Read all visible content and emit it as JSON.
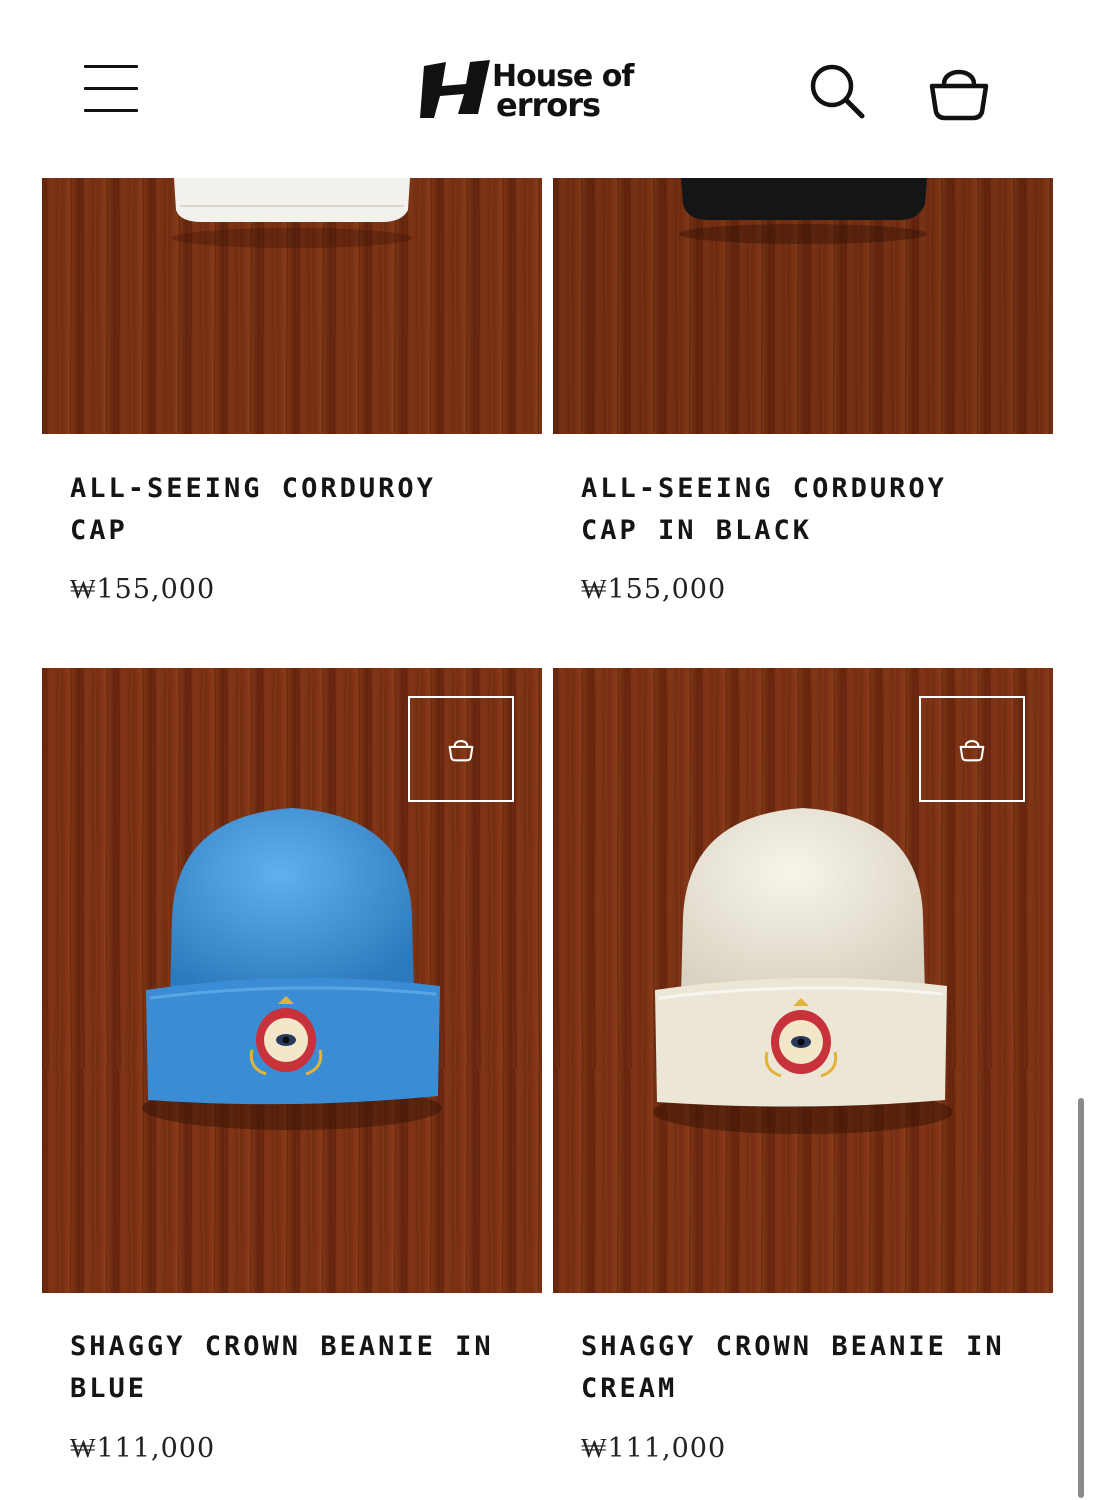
{
  "header": {
    "logo_text_line1": "House of",
    "logo_text_line2": "errors",
    "menu_icon": "hamburger-menu-icon",
    "search_icon": "search-icon",
    "cart_icon": "cart-bag-icon"
  },
  "products": [
    {
      "name": "ALL-SEEING CORDUROY CAP",
      "price": "₩155,000",
      "image": "white corduroy cap on wood"
    },
    {
      "name": "ALL-SEEING CORDUROY CAP IN BLACK",
      "price": "₩155,000",
      "image": "black corduroy cap on wood"
    },
    {
      "name": "SHAGGY CROWN BEANIE IN BLUE",
      "price": "₩111,000",
      "image": "blue shaggy beanie on wood"
    },
    {
      "name": "SHAGGY CROWN BEANIE IN CREAM",
      "price": "₩111,000",
      "image": "cream shaggy beanie on wood"
    }
  ],
  "colors": {
    "wood": "#7a2f12",
    "blue_beanie": "#3f92d6",
    "cream_beanie": "#ece8da",
    "text": "#151515"
  }
}
